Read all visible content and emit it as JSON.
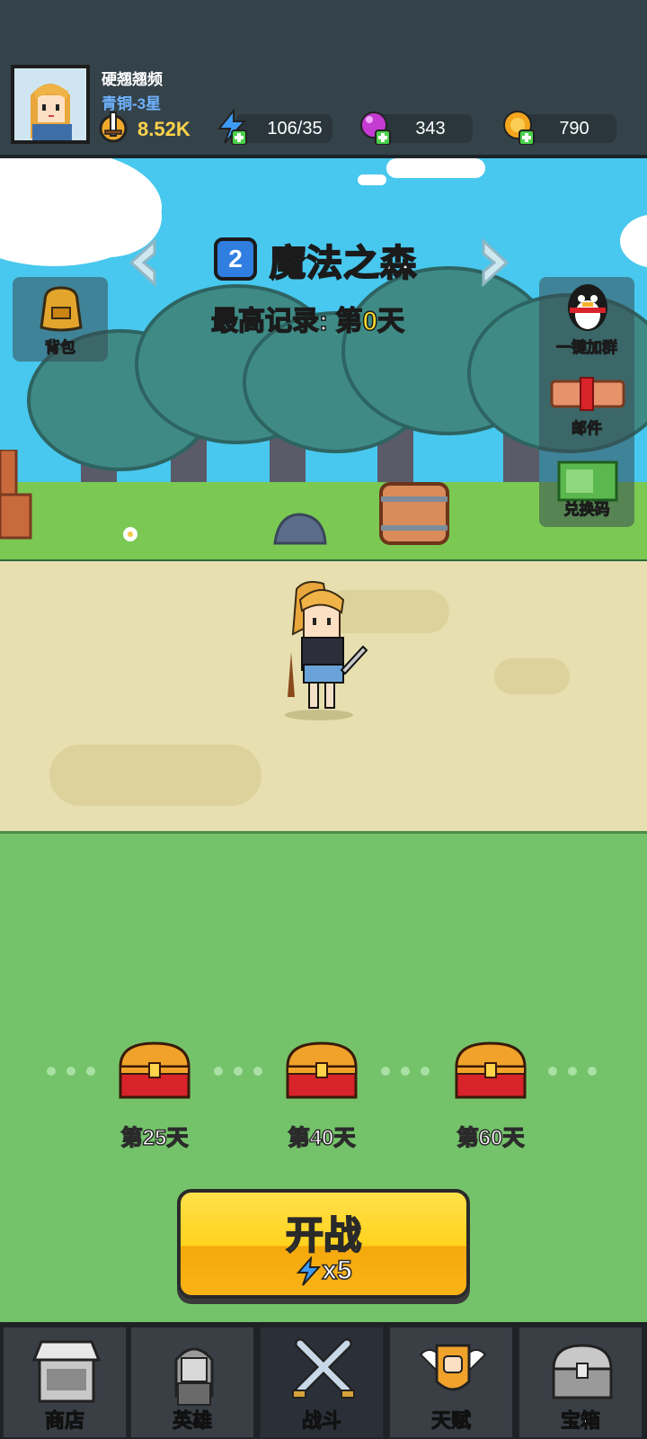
{
  "player": {
    "name": "硬翘翘频",
    "rank": "青铜-3星"
  },
  "resources": {
    "power": "8.52K",
    "energy": "106/35",
    "gems": "343",
    "coins": "790"
  },
  "stage": {
    "number": "2",
    "name": "魔法之森",
    "record_prefix": "最高记录: 第",
    "record_value": "0",
    "record_suffix": "天"
  },
  "side_buttons": {
    "backpack": "背包",
    "join_group": "一键加群",
    "mail": "邮件",
    "redeem": "兑换码"
  },
  "milestones": [
    {
      "label": "第25天"
    },
    {
      "label": "第40天"
    },
    {
      "label": "第60天"
    }
  ],
  "start_button": {
    "label": "开战",
    "cost": "x5"
  },
  "nav": [
    {
      "label": "商店"
    },
    {
      "label": "英雄"
    },
    {
      "label": "战斗"
    },
    {
      "label": "天赋"
    },
    {
      "label": "宝箱"
    }
  ],
  "active_nav": "战斗",
  "colors": {
    "accent_yellow": "#ffd21e",
    "rank_blue": "#6fb3ff",
    "grass": "#74c36a",
    "sky": "#48c8ee"
  }
}
